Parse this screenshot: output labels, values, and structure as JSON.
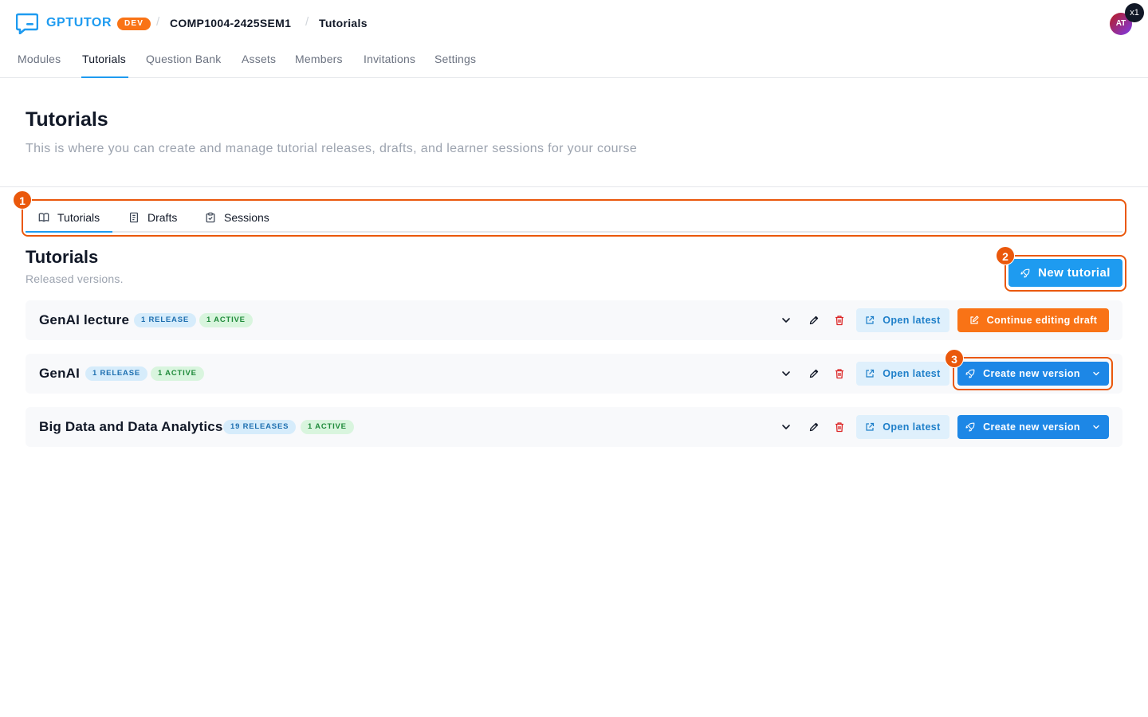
{
  "header": {
    "brand": "GPTUTOR",
    "env_badge": "DEV",
    "breadcrumb": [
      "COMP1004-2425SEM1",
      "Tutorials"
    ],
    "avatar_initials": "AT",
    "zoom_label": "x1"
  },
  "nav": {
    "items": [
      "Modules",
      "Tutorials",
      "Question Bank",
      "Assets",
      "Members",
      "Invitations",
      "Settings"
    ],
    "active": "Tutorials"
  },
  "page": {
    "title": "Tutorials",
    "subtitle": "This is where you can create and manage tutorial releases, drafts, and learner sessions for your course"
  },
  "tabs": {
    "items": [
      {
        "label": "Tutorials",
        "icon": "book-icon"
      },
      {
        "label": "Drafts",
        "icon": "draft-icon"
      },
      {
        "label": "Sessions",
        "icon": "clipboard-icon"
      }
    ],
    "active": "Tutorials"
  },
  "section": {
    "title": "Tutorials",
    "subtitle": "Released versions.",
    "new_button": "New tutorial"
  },
  "tutorials": [
    {
      "title": "GenAI lecture",
      "releases": "1 RELEASE",
      "active": "1 ACTIVE",
      "open_label": "Open latest",
      "action_label": "Continue editing draft",
      "action_type": "draft"
    },
    {
      "title": "GenAI",
      "releases": "1 RELEASE",
      "active": "1 ACTIVE",
      "open_label": "Open latest",
      "action_label": "Create new version",
      "action_type": "version"
    },
    {
      "title": "Big Data and Data Analytics",
      "releases": "19 RELEASES",
      "active": "1 ACTIVE",
      "open_label": "Open latest",
      "action_label": "Create new version",
      "action_type": "version"
    }
  ],
  "annotations": [
    "1",
    "2",
    "3"
  ],
  "colors": {
    "accent": "#1e9bf0",
    "annotation": "#ea580c",
    "draft_button": "#f97316",
    "release_pill": "#d6ecfb",
    "active_pill": "#d9f5de",
    "delete": "#dc2626"
  }
}
